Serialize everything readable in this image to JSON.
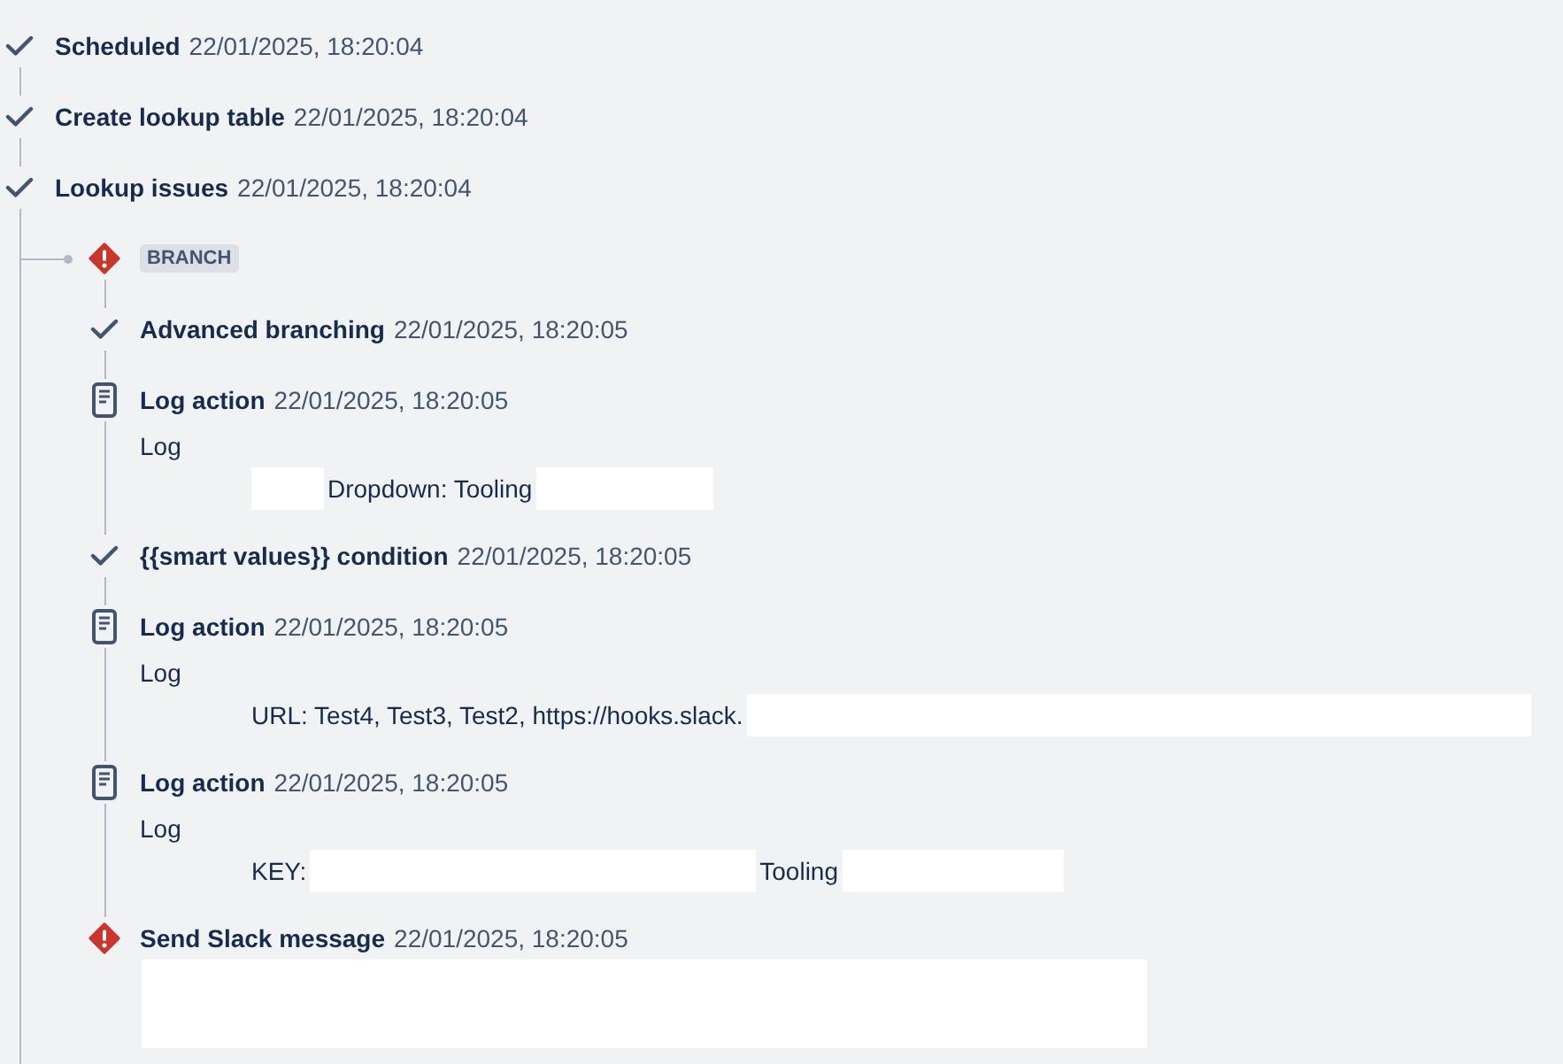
{
  "steps": [
    {
      "kind": "success",
      "title": "Scheduled",
      "time": "22/01/2025, 18:20:04"
    },
    {
      "kind": "success",
      "title": "Create lookup table",
      "time": "22/01/2025, 18:20:04"
    },
    {
      "kind": "success",
      "title": "Lookup issues",
      "time": "22/01/2025, 18:20:04",
      "branch": {
        "kind": "error",
        "label": "BRANCH",
        "steps": [
          {
            "kind": "success",
            "title": "Advanced branching",
            "time": "22/01/2025, 18:20:05"
          },
          {
            "kind": "log",
            "title": "Log action",
            "time": "22/01/2025, 18:20:05",
            "log_label": "Log",
            "lines": [
              {
                "segments": [
                  {
                    "kind": "redacted"
                  },
                  {
                    "kind": "text",
                    "text": "Dropdown: Tooling"
                  },
                  {
                    "kind": "redacted"
                  }
                ]
              }
            ]
          },
          {
            "kind": "success",
            "title": "{{smart values}} condition",
            "time": "22/01/2025, 18:20:05"
          },
          {
            "kind": "log",
            "title": "Log action",
            "time": "22/01/2025, 18:20:05",
            "log_label": "Log",
            "lines": [
              {
                "segments": [
                  {
                    "kind": "text",
                    "text": "URL: Test4, Test3, Test2, https://hooks.slack."
                  },
                  {
                    "kind": "redacted"
                  }
                ]
              }
            ]
          },
          {
            "kind": "log",
            "title": "Log action",
            "time": "22/01/2025, 18:20:05",
            "log_label": "Log",
            "lines": [
              {
                "segments": [
                  {
                    "kind": "text",
                    "text": "KEY:"
                  },
                  {
                    "kind": "redacted"
                  },
                  {
                    "kind": "text",
                    "text": "Tooling"
                  },
                  {
                    "kind": "redacted"
                  }
                ]
              }
            ]
          },
          {
            "kind": "error",
            "title": "Send Slack message",
            "time": "22/01/2025, 18:20:05",
            "body": {
              "kind": "redacted"
            }
          }
        ]
      }
    }
  ]
}
